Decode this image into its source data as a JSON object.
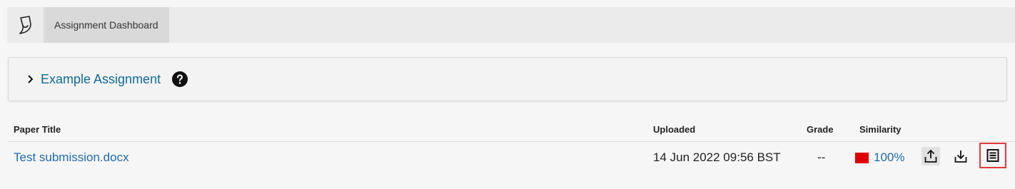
{
  "topbar": {
    "logo_icon": "turnitin-logo-icon",
    "tab_label": "Assignment Dashboard"
  },
  "assignment": {
    "title": "Example Assignment",
    "expand_icon": "chevron-right-icon",
    "help_icon": "question-circle-icon"
  },
  "table": {
    "headers": {
      "paper_title": "Paper Title",
      "uploaded": "Uploaded",
      "grade": "Grade",
      "similarity": "Similarity"
    },
    "rows": [
      {
        "paper_title": "Test submission.docx",
        "uploaded": "14 Jun 2022 09:56 BST",
        "grade": "--",
        "similarity": "100%",
        "similarity_color": "#e00000",
        "actions": [
          "upload-icon",
          "download-icon",
          "report-icon"
        ]
      }
    ]
  },
  "colors": {
    "link": "#1f6aa8",
    "title_link": "#0f6a96",
    "highlight_border": "#e03a3a"
  }
}
